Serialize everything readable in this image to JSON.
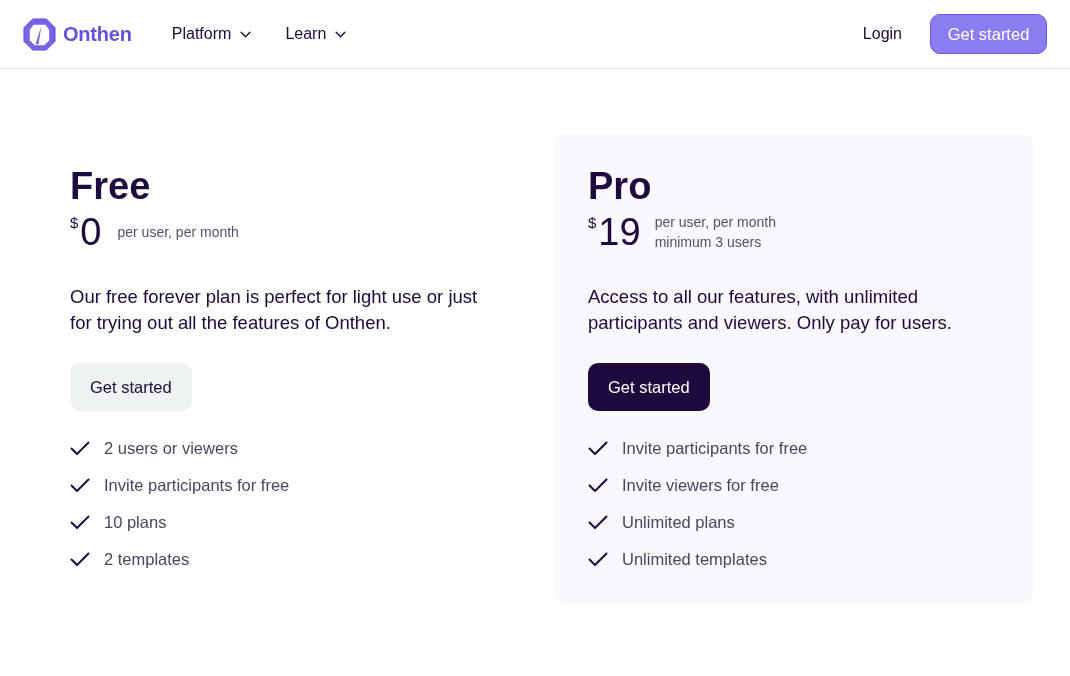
{
  "header": {
    "logo": {
      "name": "Onthen"
    },
    "nav": [
      {
        "label": "Platform"
      },
      {
        "label": "Learn"
      }
    ],
    "login": "Login",
    "cta": "Get started"
  },
  "plans": [
    {
      "kind": "plain",
      "name": "Free",
      "currency": "$",
      "price": "0",
      "price_notes": [
        "per user, per month"
      ],
      "description": "Our free forever plan is perfect for light use or just for trying out all the features of Onthen.",
      "button": "Get started",
      "features": [
        "2 users or viewers",
        "Invite participants for free",
        "10 plans",
        "2 templates"
      ]
    },
    {
      "kind": "featured",
      "name": "Pro",
      "currency": "$",
      "price": "19",
      "price_notes": [
        "per user, per month",
        "minimum 3 users"
      ],
      "description": "Access to all our features, with unlimited participants and viewers. Only pay for users.",
      "button": "Get started",
      "features": [
        "Invite participants for free",
        "Invite viewers for free",
        "Unlimited plans",
        "Unlimited templates"
      ]
    }
  ]
}
